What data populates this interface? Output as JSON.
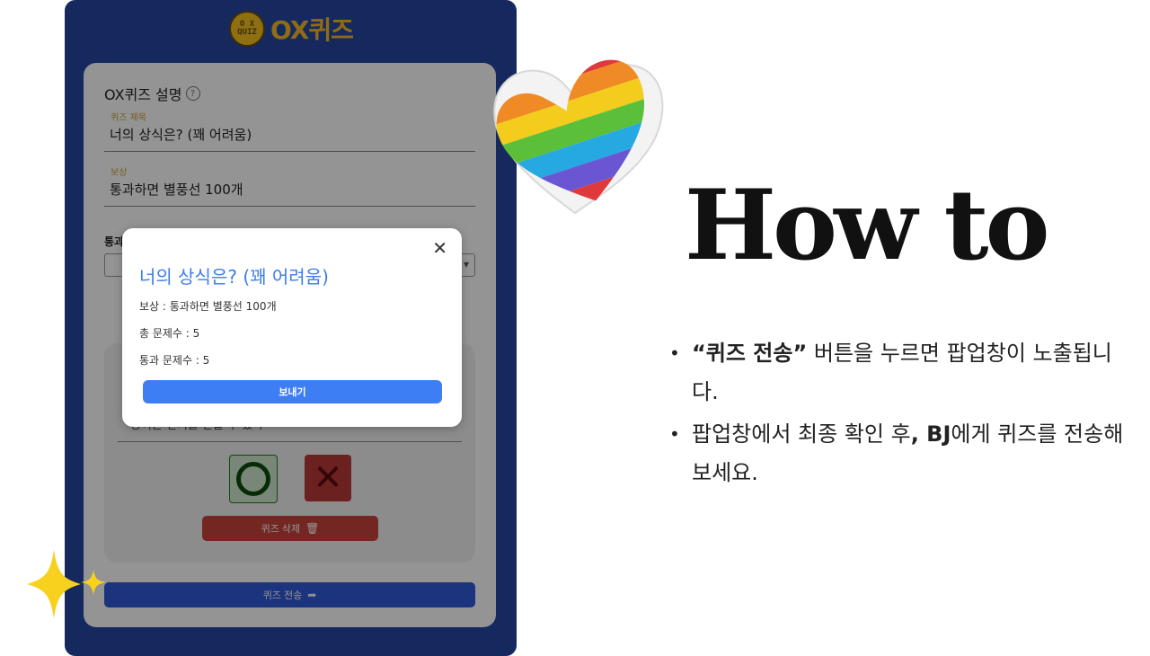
{
  "logo": {
    "badge_top": "O X",
    "badge_bottom": "QUIZ",
    "text": "OX퀴즈"
  },
  "form": {
    "section_title": "OX퀴즈 설명",
    "help_icon": "?",
    "quiz_title_label": "퀴즈 제목",
    "quiz_title_value": "너의 상식은? (꽤 어려움)",
    "reward_label": "보상",
    "reward_value": "통과하면 별풍선 100개",
    "pass_label": "통과",
    "question_text": "장어는 전기를 만들 수 있다",
    "o_label": "O",
    "x_label": "✕",
    "delete_button": "퀴즈 삭제",
    "send_button": "퀴즈 전송"
  },
  "modal": {
    "close": "✕",
    "title": "너의 상식은? (꽤 어려움)",
    "reward": "보상 : 통과하면 별풍선 100개",
    "total": "총 문제수 : 5",
    "pass": "통과 문제수 : 5",
    "send_button": "보내기"
  },
  "howto": {
    "title": "How to",
    "bullet1_bold": "“퀴즈 전송”",
    "bullet1_rest": " 버튼을 누르면 팝업창이 노출됩니다.",
    "bullet2_a": "팝업창에서 최종 확인 후",
    "bullet2_bold": ", BJ",
    "bullet2_b": "에게 퀴즈를 전송해보세요."
  },
  "colors": {
    "phone_bg": "#2747a3",
    "accent_blue": "#3d7ef5",
    "delete_red": "#c9433d",
    "logo_yellow": "#f5b928"
  },
  "icons": [
    "help-icon",
    "trash-icon",
    "share-icon",
    "close-icon",
    "sparkle-icon",
    "rainbow-heart-icon"
  ]
}
